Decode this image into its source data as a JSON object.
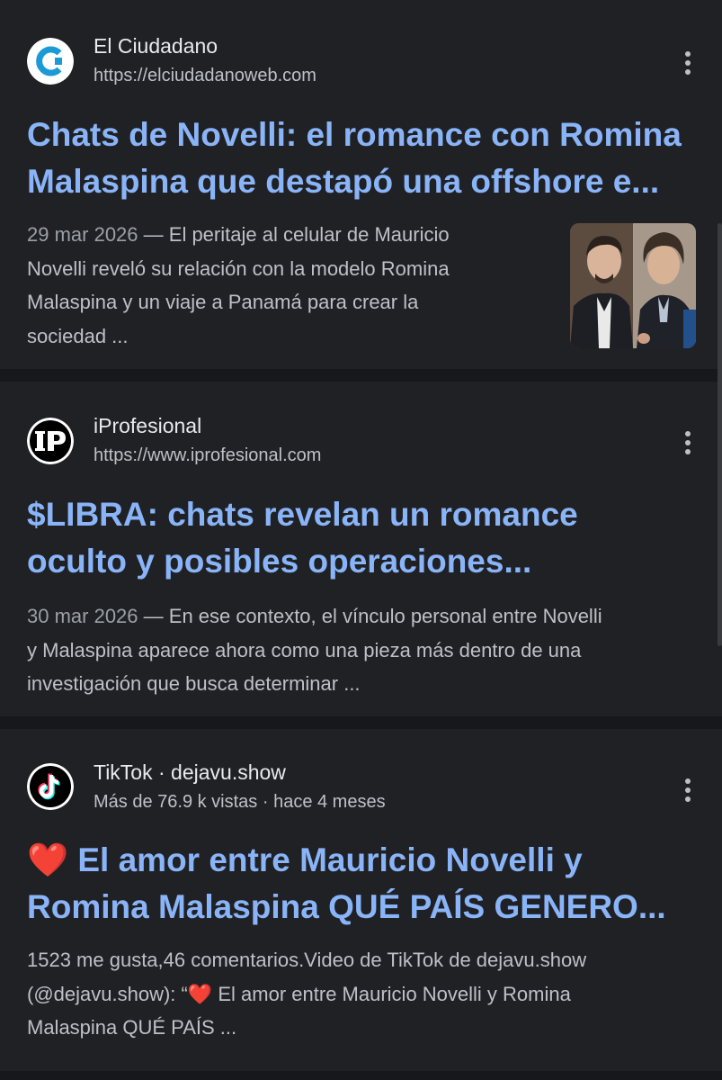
{
  "results": [
    {
      "source": "El Ciudadano",
      "url": "https://elciudadanoweb.com",
      "icon": "el-ciudadano-logo-icon",
      "title_lines": [
        "Chats de Novelli: el romance con Romina",
        "Malaspina que destapó una offshore e..."
      ],
      "date": "29 mar 2026",
      "snippet_lines": [
        "— El peritaje al celular de Mauricio",
        "Novelli reveló su relación con la modelo Romina",
        "Malaspina y un viaje a Panamá para crear la",
        "sociedad ..."
      ],
      "thumbnail": "photo-two-men-thumbnail"
    },
    {
      "source": "iProfesional",
      "url": "https://www.iprofesional.com",
      "icon": "iprofesional-logo-icon",
      "title_lines": [
        "$LIBRA: chats revelan un romance",
        "oculto y posibles operaciones..."
      ],
      "date": "30 mar 2026",
      "snippet_lines": [
        "— En ese contexto, el vínculo personal entre Novelli",
        "y Malaspina aparece ahora como una pieza más dentro de una",
        "investigación que busca determinar ..."
      ]
    },
    {
      "source": "TikTok · dejavu.show",
      "meta": "Más de 76.9 k vistas · hace 4 meses",
      "icon": "tiktok-logo-icon",
      "title_emoji": "❤️",
      "title_lines": [
        "El amor entre Mauricio Novelli y",
        "Romina Malaspina QUÉ PAÍS GENERO..."
      ],
      "snippet_lines": [
        "1523 me gusta,46 comentarios.Video de TikTok de dejavu.show",
        "(@dejavu.show): “",
        "El amor entre Mauricio Novelli y Romina",
        "Malaspina QUÉ PAÍS ..."
      ],
      "snippet_emoji": "❤️"
    }
  ],
  "colors": {
    "background": "#17181c",
    "card": "#202124",
    "link": "#8ab4f8",
    "text": "#bdc1c6",
    "heart": "#e0313b"
  }
}
